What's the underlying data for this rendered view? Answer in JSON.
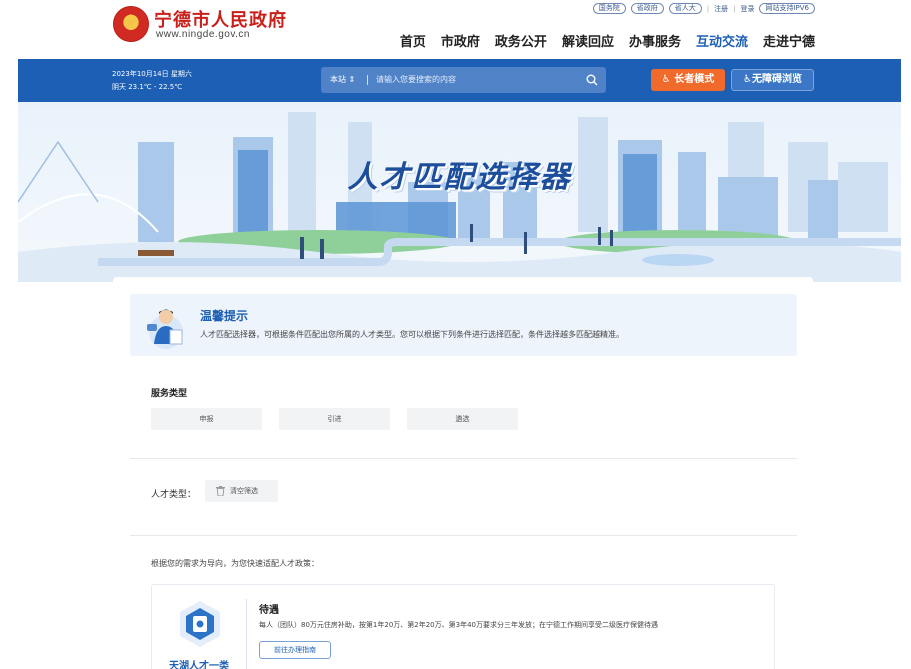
{
  "header": {
    "site_name": "宁德市人民政府",
    "site_url": "www.ningde.gov.cn",
    "top_links": [
      "国务院",
      "省政府",
      "省人大"
    ],
    "register": "注册",
    "login": "登录",
    "ipv6": "网站支持IPV6",
    "nav": [
      "首页",
      "市政府",
      "政务公开",
      "解读回应",
      "办事服务",
      "互动交流",
      "走进宁德"
    ],
    "nav_active_index": 5
  },
  "bluebar": {
    "date": "2023年10月14日 星期六",
    "weather": "阴天  23.1℃ - 22.5℃",
    "search_scope": "本站",
    "search_placeholder": "请输入您要搜索的内容",
    "elder_mode": "长者模式",
    "accessible": "无障碍浏览"
  },
  "banner": {
    "title": "人才匹配选择器"
  },
  "tip": {
    "title": "温馨提示",
    "text": "人才匹配选择器，可根据条件匹配出您所属的人才类型。您可以根据下列条件进行选择匹配，条件选择越多匹配越精准。"
  },
  "service": {
    "label": "服务类型",
    "options": [
      "申报",
      "引进",
      "遴选"
    ]
  },
  "talent": {
    "label": "人才类型：",
    "clear": "清空筛选"
  },
  "guide": "根据您的需求为导向，为您快速适配人才政策：",
  "policy": {
    "name": "天湖人才一类",
    "title": "待遇",
    "desc": "每人（团队）80万元住房补助，按第1年20万、第2年20万、第3年40万要求分三年发放；在宁德工作期间享受二级医疗保健待遇",
    "button": "前往办理指南"
  },
  "colors": {
    "primary": "#1d5fb4",
    "elder": "#f06a2b",
    "brand_red": "#c9201b"
  }
}
